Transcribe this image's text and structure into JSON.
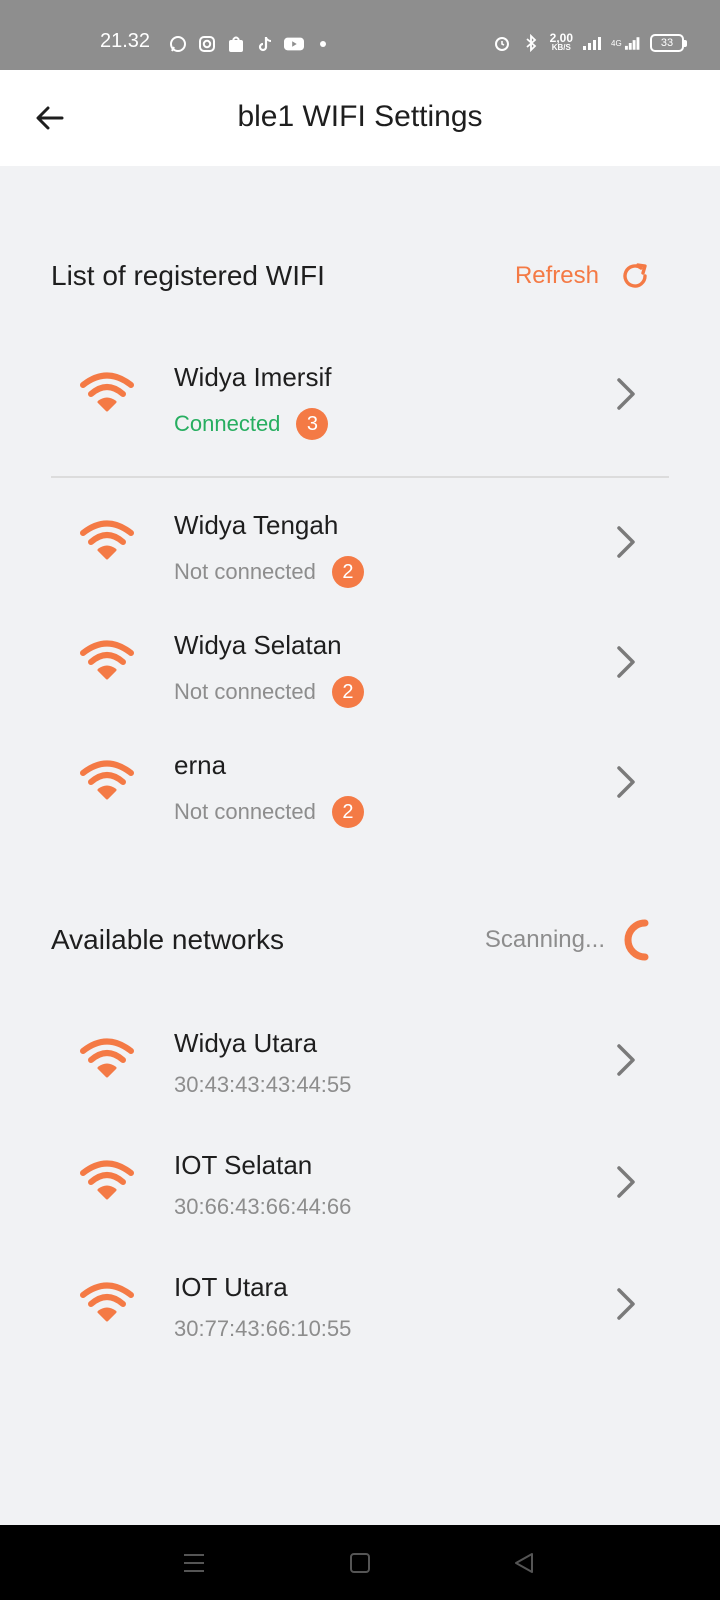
{
  "status_bar": {
    "time": "21.32",
    "speed_value": "2,00",
    "speed_unit": "KB/S",
    "network": "4G",
    "battery": "33",
    "left_icons": [
      "whatsapp-icon",
      "instagram-icon",
      "shopee-icon",
      "tiktok-icon",
      "youtube-icon",
      "dot-icon"
    ],
    "right_icons": [
      "alarm-icon",
      "bluetooth-icon",
      "signal-icon",
      "signal-4g-icon",
      "battery-icon"
    ]
  },
  "header": {
    "title": "ble1 WIFI Settings",
    "back_icon": "arrow-left-icon"
  },
  "registered": {
    "title": "List of registered WIFI",
    "refresh_label": "Refresh",
    "refresh_icon": "refresh-icon",
    "items": [
      {
        "name": "Widya Imersif",
        "status": "Connected",
        "count": "3",
        "connected": true
      },
      {
        "name": "Widya Tengah",
        "status": "Not connected",
        "count": "2",
        "connected": false
      },
      {
        "name": "Widya Selatan",
        "status": "Not connected",
        "count": "2",
        "connected": false
      },
      {
        "name": "erna",
        "status": "Not connected",
        "count": "2",
        "connected": false
      }
    ]
  },
  "available": {
    "title": "Available networks",
    "scanning_label": "Scanning...",
    "items": [
      {
        "name": "Widya Utara",
        "mac": "30:43:43:43:44:55"
      },
      {
        "name": "IOT Selatan",
        "mac": "30:66:43:66:44:66"
      },
      {
        "name": "IOT Utara",
        "mac": "30:77:43:66:10:55"
      }
    ]
  },
  "nav": {
    "icons": [
      "menu-icon",
      "home-square-icon",
      "back-triangle-icon"
    ]
  },
  "colors": {
    "accent": "#f47a45",
    "connected": "#27ae60",
    "muted": "#8d8d8d",
    "background": "#f1f2f4"
  }
}
